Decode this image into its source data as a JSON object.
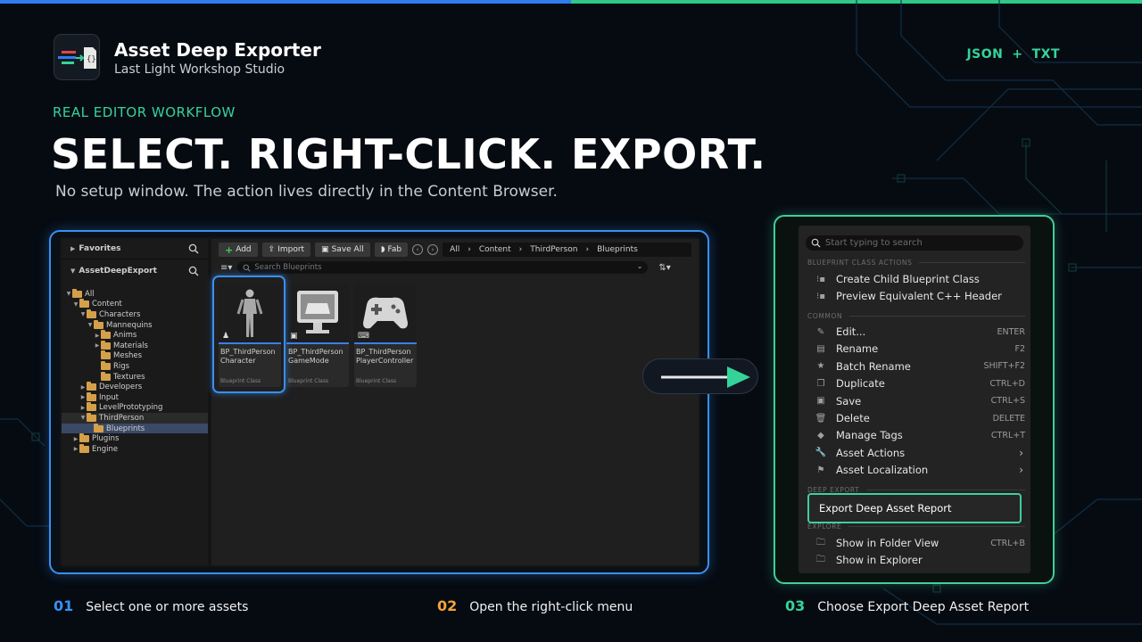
{
  "header": {
    "title": "Asset Deep Exporter",
    "subtitle": "Last Light Workshop Studio",
    "formats": {
      "a": "JSON",
      "plus": "+",
      "b": "TXT"
    }
  },
  "hero": {
    "eyebrow": "REAL EDITOR WORKFLOW",
    "headline": "SELECT. RIGHT-CLICK. EXPORT.",
    "subline": "No setup window. The action lives directly in the Content Browser."
  },
  "content_browser": {
    "favorites_label": "Favorites",
    "project_label": "AssetDeepExport",
    "tree": [
      {
        "label": "All",
        "depth": 0,
        "open": true
      },
      {
        "label": "Content",
        "depth": 1,
        "open": true
      },
      {
        "label": "Characters",
        "depth": 2,
        "open": true
      },
      {
        "label": "Mannequins",
        "depth": 3,
        "open": true
      },
      {
        "label": "Anims",
        "depth": 4,
        "open": false
      },
      {
        "label": "Materials",
        "depth": 4,
        "open": false
      },
      {
        "label": "Meshes",
        "depth": 4,
        "open": false
      },
      {
        "label": "Rigs",
        "depth": 4,
        "open": false
      },
      {
        "label": "Textures",
        "depth": 4,
        "open": false
      },
      {
        "label": "Developers",
        "depth": 2,
        "open": false
      },
      {
        "label": "Input",
        "depth": 2,
        "open": false
      },
      {
        "label": "LevelPrototyping",
        "depth": 2,
        "open": false
      },
      {
        "label": "ThirdPerson",
        "depth": 2,
        "open": true
      },
      {
        "label": "Blueprints",
        "depth": 3,
        "open": false
      },
      {
        "label": "Plugins",
        "depth": 1,
        "open": false
      },
      {
        "label": "Engine",
        "depth": 1,
        "open": false
      }
    ],
    "toolbar": {
      "add": "Add",
      "import": "Import",
      "save_all": "Save All",
      "fab": "Fab"
    },
    "breadcrumbs": [
      "All",
      "Content",
      "ThirdPerson",
      "Blueprints"
    ],
    "search_placeholder": "Search Blueprints",
    "assets": [
      {
        "name_line1": "BP_ThirdPerson",
        "name_line2": "Character",
        "class": "Blueprint Class"
      },
      {
        "name_line1": "BP_ThirdPerson",
        "name_line2": "GameMode",
        "class": "Blueprint Class"
      },
      {
        "name_line1": "BP_ThirdPerson",
        "name_line2": "PlayerController",
        "class": "Blueprint Class"
      }
    ]
  },
  "context_menu": {
    "search_placeholder": "Start typing to search",
    "sections": {
      "blueprint": "BLUEPRINT CLASS ACTIONS",
      "common": "COMMON",
      "deep_export": "DEEP EXPORT",
      "explore": "EXPLORE"
    },
    "blueprint_items": [
      {
        "label": "Create Child Blueprint Class",
        "icon": "blueprint-node-icon"
      },
      {
        "label": "Preview Equivalent C++ Header",
        "icon": "blueprint-node-icon"
      }
    ],
    "common_items": [
      {
        "label": "Edit...",
        "shortcut": "ENTER",
        "icon": "pencil-icon"
      },
      {
        "label": "Rename",
        "shortcut": "F2",
        "icon": "rename-icon"
      },
      {
        "label": "Batch Rename",
        "shortcut": "SHIFT+F2",
        "icon": "star-icon"
      },
      {
        "label": "Duplicate",
        "shortcut": "CTRL+D",
        "icon": "duplicate-icon"
      },
      {
        "label": "Save",
        "shortcut": "CTRL+S",
        "icon": "save-icon"
      },
      {
        "label": "Delete",
        "shortcut": "DELETE",
        "icon": "trash-icon"
      },
      {
        "label": "Manage Tags",
        "shortcut": "CTRL+T",
        "icon": "tag-icon"
      },
      {
        "label": "Asset Actions",
        "shortcut": "",
        "icon": "wrench-icon",
        "submenu": true
      },
      {
        "label": "Asset Localization",
        "shortcut": "",
        "icon": "flag-icon",
        "submenu": true
      }
    ],
    "export_item": "Export Deep Asset Report",
    "explore_items": [
      {
        "label": "Show in Folder View",
        "shortcut": "CTRL+B",
        "icon": "folder-search-icon"
      },
      {
        "label": "Show in Explorer",
        "shortcut": "",
        "icon": "folder-search-icon"
      }
    ]
  },
  "steps": [
    {
      "num": "01",
      "label": "Select one or more assets",
      "color": "#3a8ff2"
    },
    {
      "num": "02",
      "label": "Open the right-click menu",
      "color": "#f0a53a"
    },
    {
      "num": "03",
      "label": "Choose Export Deep Asset Report",
      "color": "#35d39a"
    }
  ],
  "colors": {
    "blue": "#3a8ff2",
    "green": "#35d39a",
    "orange": "#f0a53a"
  }
}
